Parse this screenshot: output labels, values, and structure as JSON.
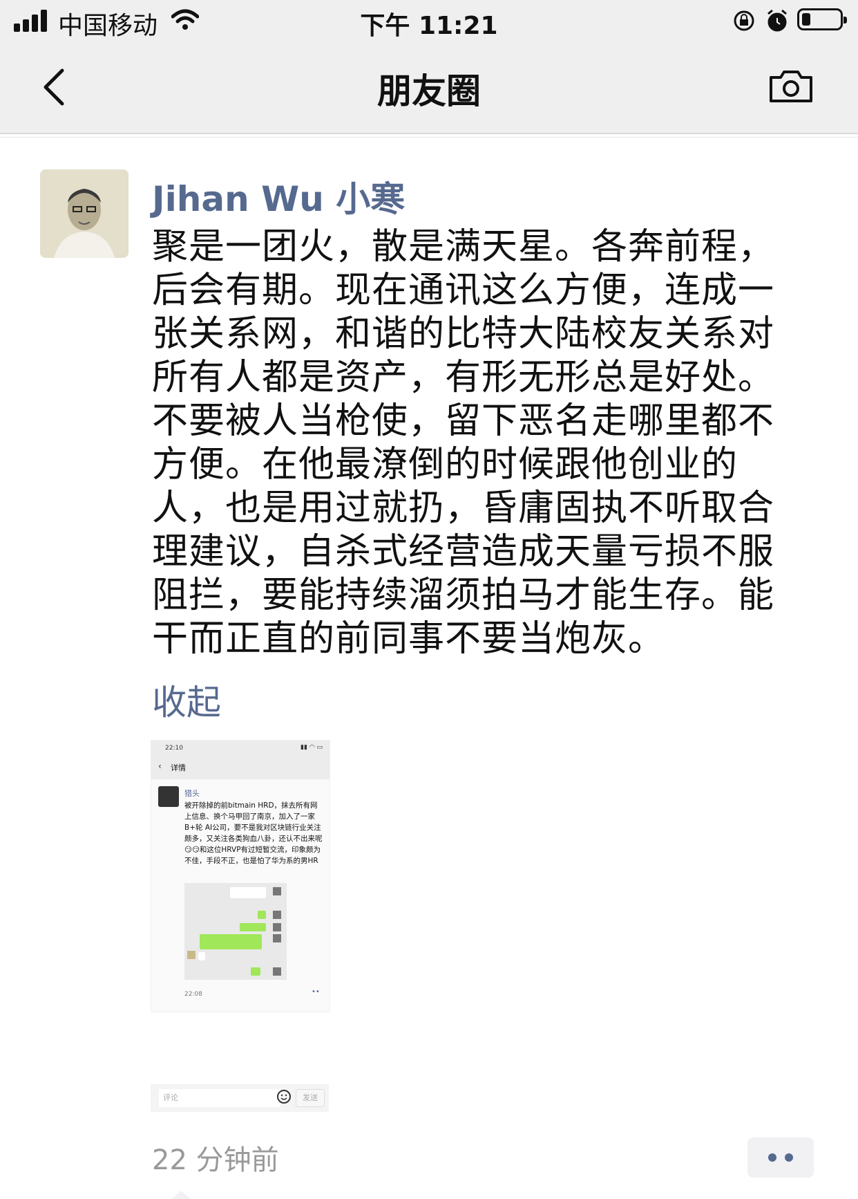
{
  "status_bar": {
    "carrier": "中国移动",
    "time": "下午 11:21"
  },
  "nav": {
    "title": "朋友圈"
  },
  "moment": {
    "author": "Jihan Wu 小寒",
    "text": "聚是一团火，散是满天星。各奔前程，后会有期。现在通讯这么方便，连成一张关系网，和谐的比特大陆校友关系对所有人都是资产，有形无形总是好处。不要被人当枪使，留下恶名走哪里都不方便。在他最潦倒的时候跟他创业的人，也是用过就扔，昏庸固执不听取合理建议，自杀式经营造成天量亏损不服阻拦，要能持续溜须拍马才能生存。能干而正直的前同事不要当炮灰。",
    "collapse_label": "收起",
    "time_ago": "22 分钟前"
  },
  "attached_screenshot": {
    "status_time": "22:10",
    "header": "详情",
    "poster_name": "猎头",
    "text": "被开除掉的前bitmain HRD，抹去所有网上信息、换个马甲回了南京，加入了一家B+轮 AI公司，要不是我对区块链行业关注颇多，又关注各类狗血八卦，还认不出来呢😏😏和这位HRVP有过短暂交流，印象颇为不佳，手段不正，也是怕了华为系的男HR",
    "post_time": "22:08",
    "comment_placeholder": "评论",
    "send_label": "发送"
  },
  "colors": {
    "link_blue": "#56698f",
    "nav_bg": "#efeff0"
  },
  "icons": [
    "back-chevron-icon",
    "camera-icon",
    "wifi-icon",
    "signal-icon",
    "rotation-lock-icon",
    "alarm-icon",
    "battery-icon",
    "more-dots-icon"
  ]
}
